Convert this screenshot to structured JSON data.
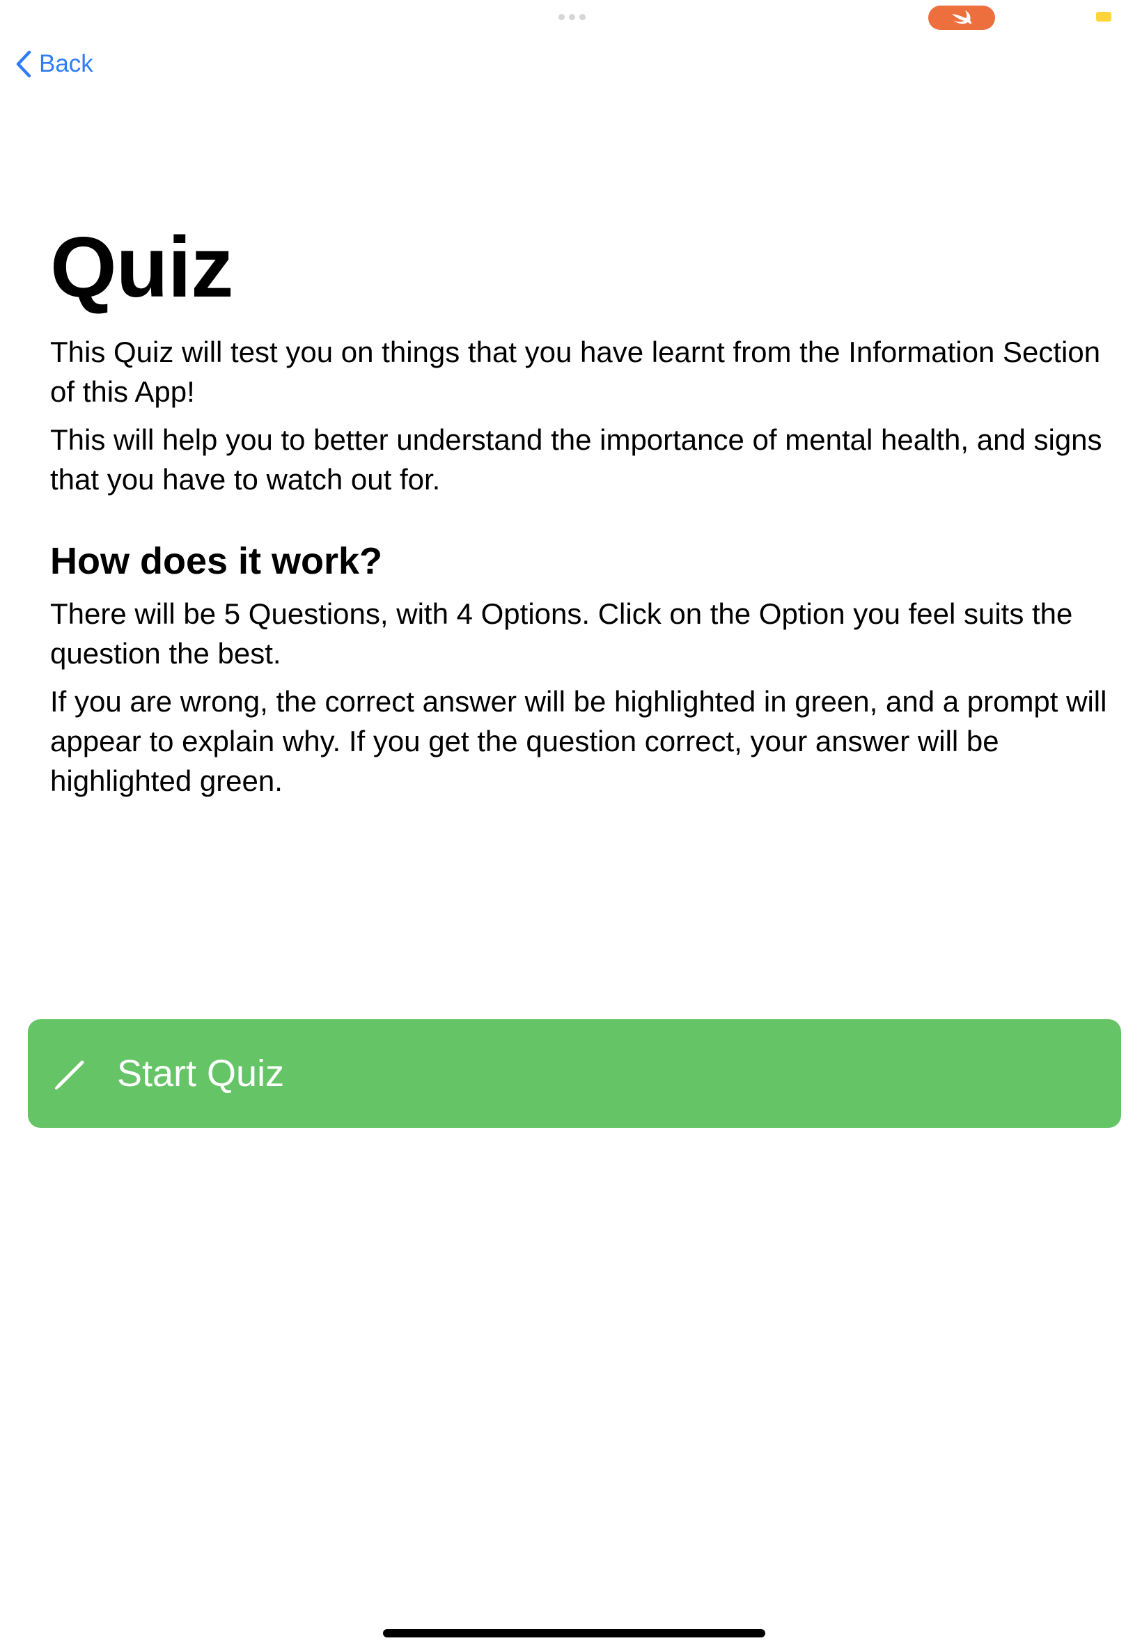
{
  "nav": {
    "back_label": "Back"
  },
  "content": {
    "title": "Quiz",
    "intro_paragraphs": [
      "This Quiz will test you on things that you have learnt from the Information Section of this App!",
      "This will help you to better understand the importance of mental health, and signs that you have to watch out for."
    ],
    "how_heading": "How does it work?",
    "how_paragraphs": [
      "There will be 5 Questions, with 4 Options. Click on the Option you feel suits the question the best.",
      "If you are wrong, the correct answer will be highlighted in green, and a prompt will appear to explain why. If you get the question correct, your answer will be highlighted green."
    ]
  },
  "start_button": {
    "label": "Start Quiz",
    "icon": "pencil-icon"
  },
  "colors": {
    "accent_blue": "#2f7cf6",
    "button_green": "#64c466",
    "swift_orange": "#ec6f3d",
    "indicator_yellow": "#ffd43b"
  }
}
